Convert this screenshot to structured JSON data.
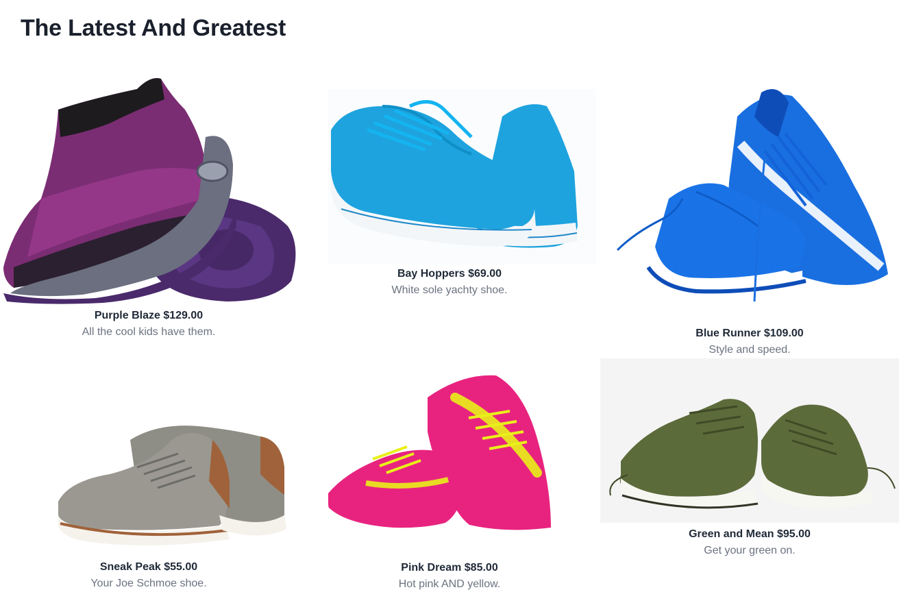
{
  "page": {
    "title": "The Latest And Greatest"
  },
  "products": [
    {
      "name": "Purple Blaze",
      "price": "$129.00",
      "description": "All the cool kids have them.",
      "image_icon": "purple-knit-sneaker-image",
      "colors": {
        "main": "#7b2d73",
        "accent": "#4a2a6b",
        "sole": "#6b6f80"
      }
    },
    {
      "name": "Bay Hoppers",
      "price": "$69.00",
      "description": "White sole yachty shoe.",
      "image_icon": "blue-canvas-sneaker-image",
      "colors": {
        "main": "#1ea3de",
        "accent": "#14b4f0",
        "sole": "#f3f6f9"
      }
    },
    {
      "name": "Blue Runner",
      "price": "$109.00",
      "description": "Style and speed.",
      "image_icon": "blue-running-shoe-image",
      "colors": {
        "main": "#1a6fe0",
        "accent": "#0e4db8",
        "sole": "#ffffff"
      }
    },
    {
      "name": "Sneak Peak",
      "price": "$55.00",
      "description": "Your Joe Schmoe shoe.",
      "image_icon": "grey-casual-shoe-image",
      "colors": {
        "main": "#9a9890",
        "accent": "#a0623a",
        "sole": "#f5f2ec"
      }
    },
    {
      "name": "Pink Dream",
      "price": "$85.00",
      "description": "Hot pink AND yellow.",
      "image_icon": "pink-running-shoe-image",
      "colors": {
        "main": "#e8237f",
        "accent": "#e9f01a",
        "sole": "#ffffff"
      }
    },
    {
      "name": "Green and Mean",
      "price": "$95.00",
      "description": "Get your green on.",
      "image_icon": "green-knit-sneaker-image",
      "colors": {
        "main": "#5c6b3a",
        "accent": "#3f4a26",
        "sole": "#f7f7f2"
      }
    }
  ]
}
